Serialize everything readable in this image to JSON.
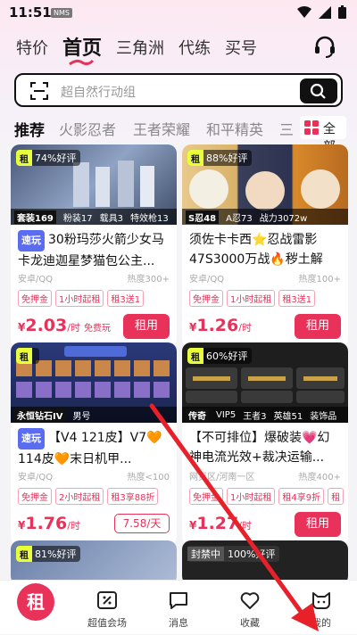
{
  "status": {
    "time": "11:51",
    "nms": "NMS"
  },
  "nav": {
    "tabs": [
      "特价",
      "首页",
      "三角洲",
      "代练",
      "买号"
    ]
  },
  "search": {
    "placeholder": "超自然行动组"
  },
  "categories": {
    "items": [
      "推荐",
      "火影忍者",
      "王者荣耀",
      "和平精英",
      "三"
    ],
    "all": "全部"
  },
  "cards": [
    {
      "rating": "74%好评",
      "tags": [
        "套装169",
        "粉装17",
        "载具3",
        "特效枪13"
      ],
      "sub": "速玩",
      "title": "30粉玛莎火箭少女马卡龙迪迦星梦猫包公主...",
      "platform": "安卓/QQ",
      "heat": "热度300+",
      "chips": [
        "免押金",
        "1小时起租",
        "租3送1"
      ],
      "price": "2.03",
      "unit": "/时",
      "free": "免费玩",
      "rent": "租用"
    },
    {
      "rating": "88%好评",
      "tags": [
        "S忍48",
        "A忍73",
        "战力3072w"
      ],
      "title": "须佐卡卡西⭐忍战雷影47S3000万战🔥秽土解斑...",
      "platform": "安卓/QQ",
      "heat": "热度100+",
      "chips": [
        "免押金",
        "1小时起租",
        "租3送1"
      ],
      "price": "1.26",
      "unit": "/时",
      "rent": "租用"
    },
    {
      "tags": [
        "永恒钻石IV",
        "男号"
      ],
      "sub": "速玩",
      "title": "【V4 121皮】V7🧡114皮🧡末日机甲...",
      "platform": "安卓/QQ",
      "heat": "热度<100",
      "chips": [
        "免押金",
        "2小时起租",
        "租3享88折"
      ],
      "price": "1.76",
      "unit": "/时",
      "day": "7.58/天"
    },
    {
      "rating": "60%好评",
      "tags": [
        "传奇",
        "VIP5",
        "王者3",
        "英雄51",
        "装饰品"
      ],
      "title": "【不可排位】爆破装💗幻神电流光效+裁决运输...",
      "platform": "网页区/河南一区",
      "heat": "热度400+",
      "chips": [
        "免押金",
        "1小时起租",
        "租4享9折",
        "租"
      ],
      "price": "1.27",
      "unit": "/时",
      "rent": "租用"
    },
    {
      "rating": "81%好评"
    },
    {
      "rating": "100%好评",
      "blocked": "封禁中"
    }
  ],
  "bottom": {
    "items": [
      "超值会场",
      "消息",
      "收藏",
      "我的"
    ],
    "logo": "租"
  }
}
